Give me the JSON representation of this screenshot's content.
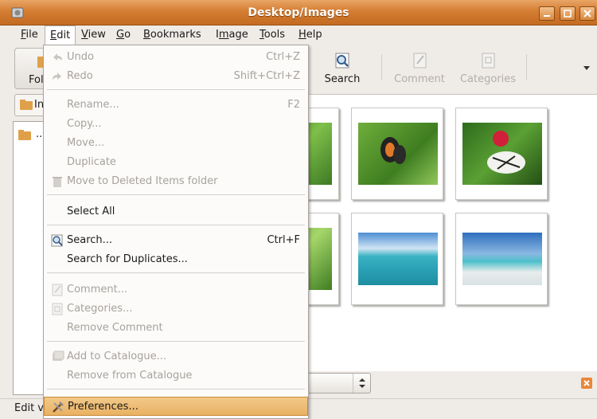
{
  "window": {
    "title": "Desktop/Images"
  },
  "menubar": {
    "items": [
      {
        "label": "File",
        "ul": "F",
        "rest": "ile"
      },
      {
        "label": "Edit",
        "ul": "E",
        "rest": "dit"
      },
      {
        "label": "View",
        "ul": "V",
        "rest": "iew"
      },
      {
        "label": "Go",
        "ul": "G",
        "rest": "o"
      },
      {
        "label": "Bookmarks",
        "ul": "B",
        "rest": "ookmarks"
      },
      {
        "label": "Image",
        "pre": "I",
        "ul": "m",
        "rest": "age"
      },
      {
        "label": "Tools",
        "ul": "T",
        "rest": "ools"
      },
      {
        "label": "Help",
        "ul": "H",
        "rest": "elp"
      }
    ]
  },
  "toolbar": {
    "folders_label": "Fol",
    "search_label": "Search",
    "comment_label": "Comment",
    "categories_label": "Categories"
  },
  "location": {
    "label": "In"
  },
  "sidebar": {
    "parent_item": ".."
  },
  "statusbar": {
    "text": "Edit v"
  },
  "edit_menu": {
    "undo": {
      "label": "Undo",
      "accel": "Ctrl+Z"
    },
    "redo": {
      "label": "Redo",
      "accel": "Shift+Ctrl+Z"
    },
    "rename": {
      "label": "Rename...",
      "accel": "F2"
    },
    "copy": {
      "label": "Copy..."
    },
    "move": {
      "label": "Move..."
    },
    "duplicate": {
      "label": "Duplicate"
    },
    "move_deleted": {
      "label": "Move to Deleted Items folder"
    },
    "select_all": {
      "label": "Select All"
    },
    "search": {
      "label": "Search...",
      "accel": "Ctrl+F"
    },
    "search_dupes": {
      "label": "Search for Duplicates..."
    },
    "comment": {
      "label": "Comment..."
    },
    "categories": {
      "label": "Categories..."
    },
    "remove_comment": {
      "label": "Remove Comment"
    },
    "add_catalogue": {
      "label": "Add to Catalogue..."
    },
    "remove_catalogue": {
      "label": "Remove from Catalogue"
    },
    "preferences": {
      "label": "Preferences..."
    }
  },
  "thumbnails": [
    {
      "subject": "green leaves"
    },
    {
      "subject": "butterfly on leaves"
    },
    {
      "subject": "butterfly on red flower"
    },
    {
      "subject": "green leaves"
    },
    {
      "subject": "coral reef"
    },
    {
      "subject": "white sand beach"
    }
  ],
  "colors": {
    "title_orange": "#d57d33",
    "menu_highlight": "#e9b162"
  }
}
